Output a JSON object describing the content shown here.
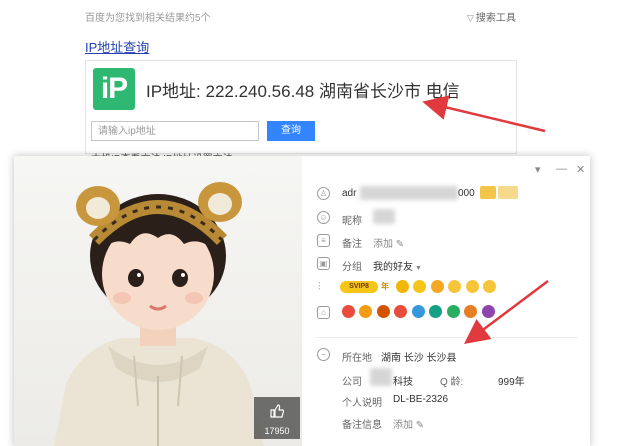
{
  "search": {
    "result_count": "百度为您找到相关结果约5个",
    "tools_label": "搜索工具",
    "result_title": "IP地址查询",
    "ip_logo": "iP",
    "ip_line": "IP地址: 222.240.56.48  湖南省长沙市 电信",
    "input_placeholder": "请输入ip地址",
    "query_button": "查询",
    "links_behind": "本机IP查看方法    IP地址设置方法"
  },
  "profile": {
    "window_controls": [
      "▾",
      "—",
      "✕"
    ],
    "account_prefix": "adr",
    "account_suffix": "000",
    "nickname_label": "昵称",
    "remark_label": "备注",
    "remark_add": "添加",
    "group_label": "分组",
    "group_value": "我的好友",
    "svip_badge": "SVIP8",
    "year_badge": "年",
    "location_label": "所在地",
    "location_value": "湖南 长沙 长沙县",
    "company_label": "公司",
    "company_value": "科技",
    "age_label": "Q  龄:",
    "age_value": "999年",
    "personal_label": "个人说明",
    "personal_value": "DL-BE-2326",
    "remark_info_label": "备注信息",
    "remark_info_add": "添加",
    "likes": "17950"
  },
  "colors": {
    "link_blue": "#2440b3",
    "ip_logo_green": "#2eb872",
    "query_button_blue": "#3385ff",
    "arrow_red": "#e0393e"
  },
  "icons": [
    "funnel-icon",
    "person-icon",
    "nickname-icon",
    "remark-icon",
    "group-icon",
    "level-icon",
    "decoration-icon",
    "location-icon",
    "pencil-icon",
    "thumbs-up-icon",
    "minimize-icon",
    "close-icon",
    "dropdown-icon"
  ]
}
